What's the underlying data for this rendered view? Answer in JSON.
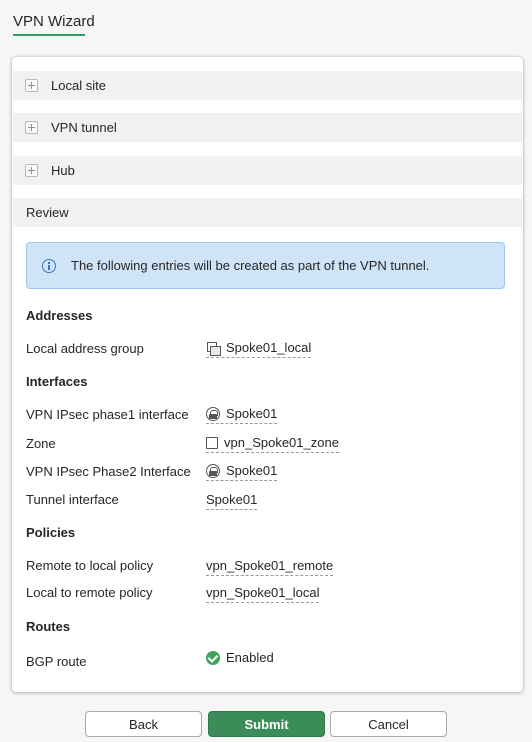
{
  "header": {
    "title": "VPN Wizard"
  },
  "sections": [
    {
      "label": "Local site"
    },
    {
      "label": "VPN tunnel"
    },
    {
      "label": "Hub"
    },
    {
      "label": "Review"
    }
  ],
  "info": {
    "text": "The following entries will be created as part of the VPN tunnel."
  },
  "groups": {
    "addresses": {
      "heading": "Addresses",
      "rows": [
        {
          "label": "Local address group",
          "value": "Spoke01_local",
          "icon": "address-group-icon"
        }
      ]
    },
    "interfaces": {
      "heading": "Interfaces",
      "rows": [
        {
          "label": "VPN IPsec phase1 interface",
          "value": "Spoke01",
          "icon": "vpn-tunnel-icon"
        },
        {
          "label": "Zone",
          "value": "vpn_Spoke01_zone",
          "icon": "zone-icon"
        },
        {
          "label": "VPN IPsec Phase2 Interface",
          "value": "Spoke01",
          "icon": "vpn-tunnel-icon"
        },
        {
          "label": "Tunnel interface",
          "value": "Spoke01",
          "icon": ""
        }
      ]
    },
    "policies": {
      "heading": "Policies",
      "rows": [
        {
          "label": "Remote to local policy",
          "value": "vpn_Spoke01_remote"
        },
        {
          "label": "Local to remote policy",
          "value": "vpn_Spoke01_local"
        }
      ]
    },
    "routes": {
      "heading": "Routes",
      "rows": [
        {
          "label": "BGP route",
          "value": "Enabled",
          "icon": "check-circle-icon"
        }
      ]
    }
  },
  "footer": {
    "back_label": "Back",
    "submit_label": "Submit",
    "cancel_label": "Cancel"
  },
  "colors": {
    "accent": "#2f9e5f",
    "submit": "#3c8c5a",
    "info_bg": "#cfe4f7",
    "info_border": "#9cc7ea",
    "enabled": "#3fa45b"
  }
}
